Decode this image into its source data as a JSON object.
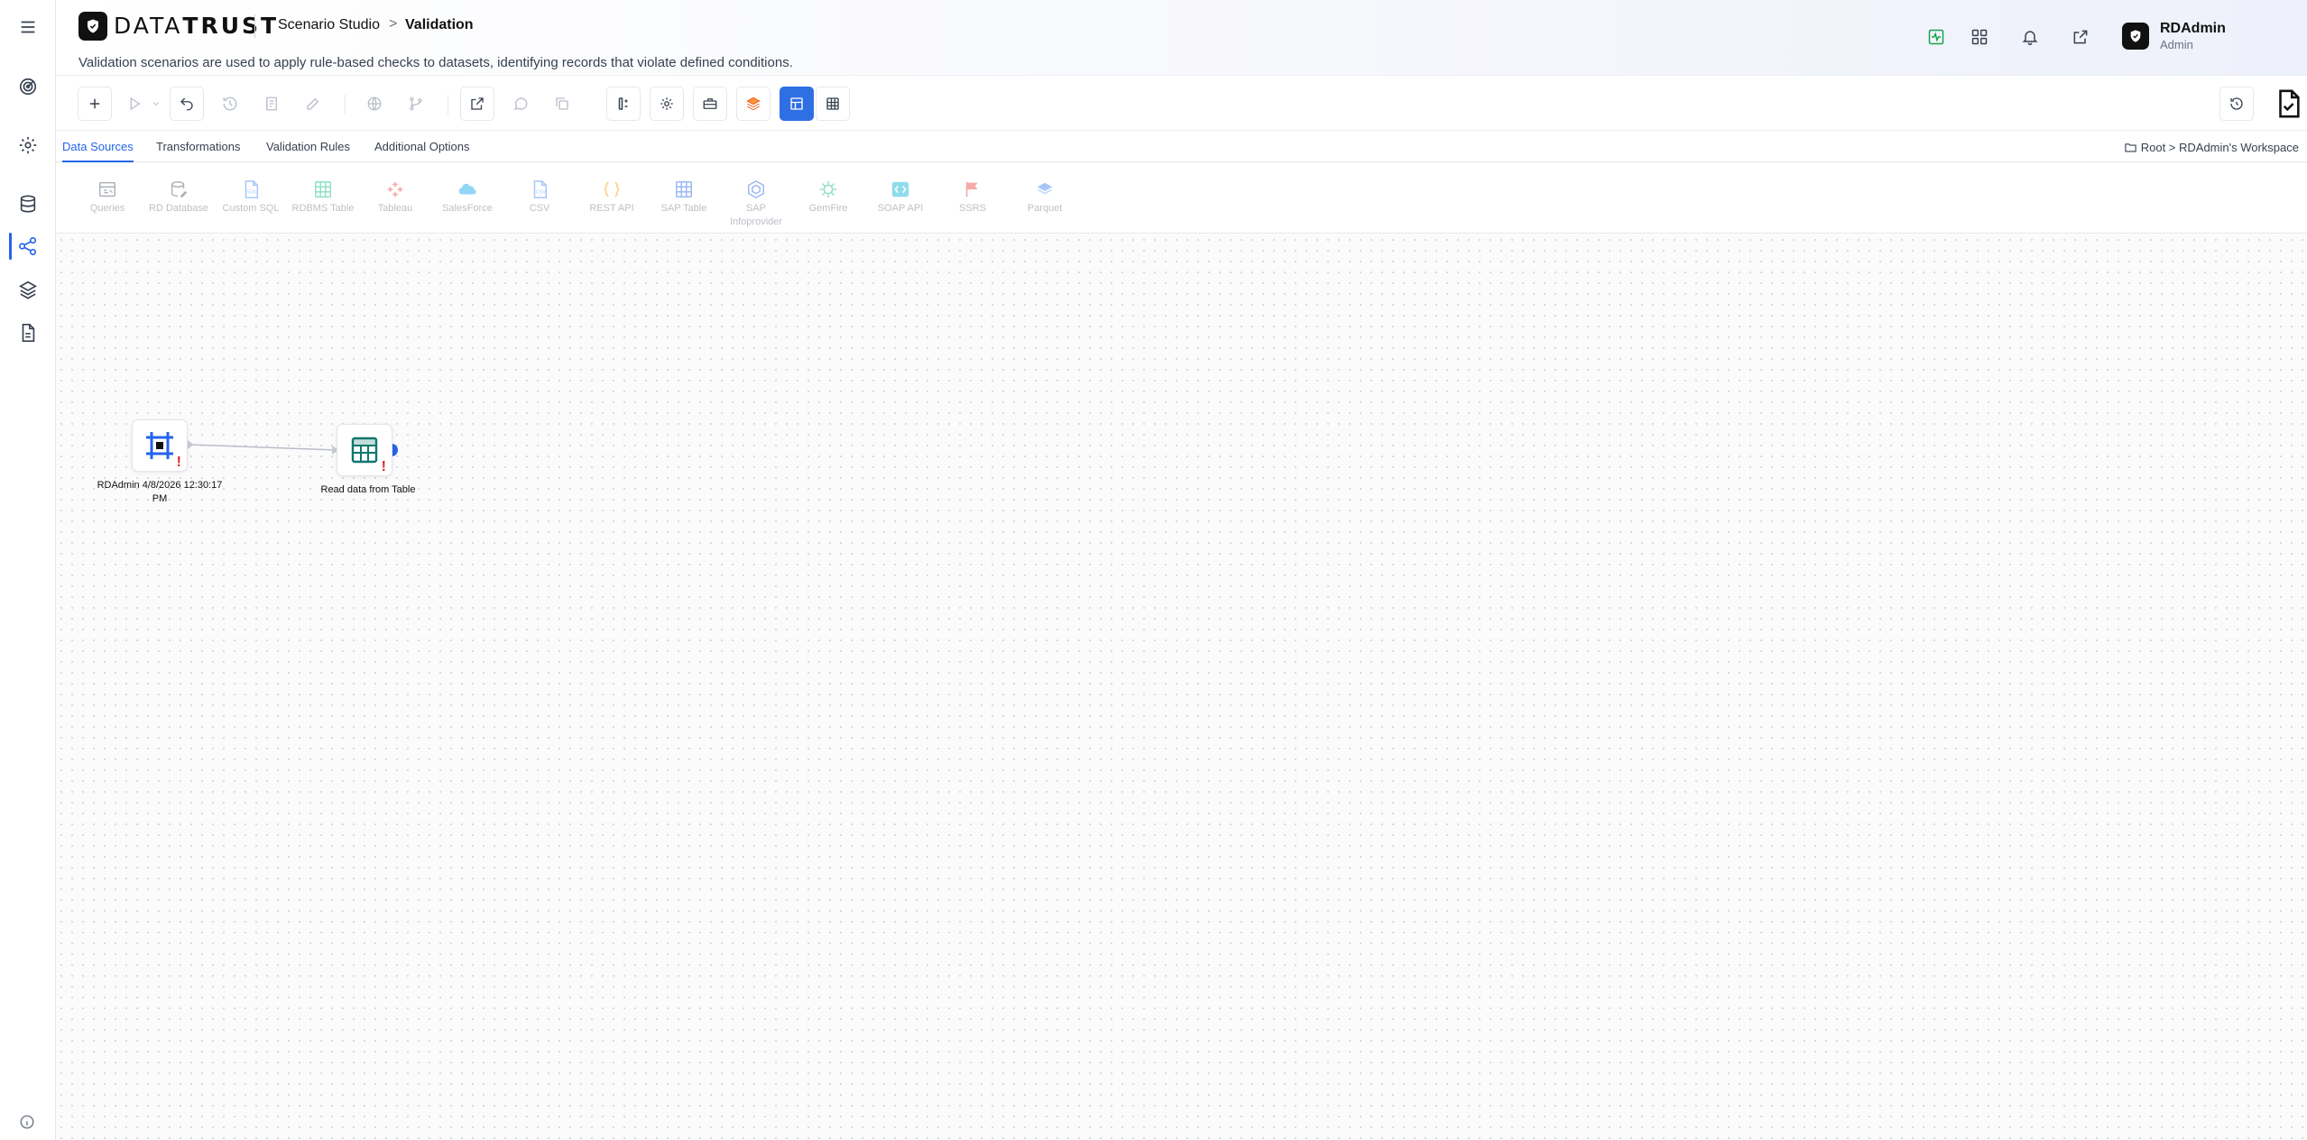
{
  "app": {
    "logo_part1": "DATA",
    "logo_part2": "TRUST",
    "breadcrumb_parent": "Scenario Studio",
    "breadcrumb_separator": ">",
    "breadcrumb_current": "Validation",
    "description": "Validation scenarios are used to apply rule-based checks to datasets, identifying records that violate defined conditions."
  },
  "user": {
    "name": "RDAdmin",
    "role": "Admin"
  },
  "left_rail": {
    "items": [
      {
        "icon": "menu-icon"
      },
      {
        "icon": "target-icon"
      },
      {
        "icon": "settings-icon"
      },
      {
        "icon": "database-icon"
      },
      {
        "icon": "scenario-flow-icon",
        "active": true
      },
      {
        "icon": "layers-icon"
      },
      {
        "icon": "report-icon"
      },
      {
        "icon": "info-icon"
      }
    ]
  },
  "header_icons": [
    "activity-icon",
    "apps-grid-icon",
    "bell-icon",
    "external-link-icon",
    "help-icon"
  ],
  "tabs": [
    {
      "label": "Data Sources",
      "active": true
    },
    {
      "label": "Transformations"
    },
    {
      "label": "Validation Rules"
    },
    {
      "label": "Additional Options"
    }
  ],
  "workspace_path": "Root > RDAdmin's Workspace",
  "palette": [
    {
      "label": "Queries",
      "color": "#6b7280"
    },
    {
      "label": "RD Database",
      "color": "#6b7280"
    },
    {
      "label": "Custom SQL",
      "color": "#3b82f6"
    },
    {
      "label": "RDBMS Table",
      "color": "#10b981"
    },
    {
      "label": "Tableau",
      "color": "#ef4444"
    },
    {
      "label": "SalesForce",
      "color": "#0ea5e9"
    },
    {
      "label": "CSV",
      "color": "#3b82f6"
    },
    {
      "label": "REST API",
      "color": "#f59e0b"
    },
    {
      "label": "SAP Table",
      "color": "#2563eb"
    },
    {
      "label": "SAP Infoprovider",
      "color": "#2563eb"
    },
    {
      "label": "GemFire",
      "color": "#10b981"
    },
    {
      "label": "SOAP API",
      "color": "#06b6d4"
    },
    {
      "label": "SSRS",
      "color": "#ef4444"
    },
    {
      "label": "Parquet",
      "color": "#3b82f6"
    }
  ],
  "nodes": [
    {
      "label": "RDAdmin 4/8/2026 12:30:17 PM",
      "warning": "!"
    },
    {
      "label": "Read data from Table",
      "warning": "!"
    }
  ],
  "colors": {
    "accent": "#2563eb",
    "warning": "#dc2626"
  }
}
